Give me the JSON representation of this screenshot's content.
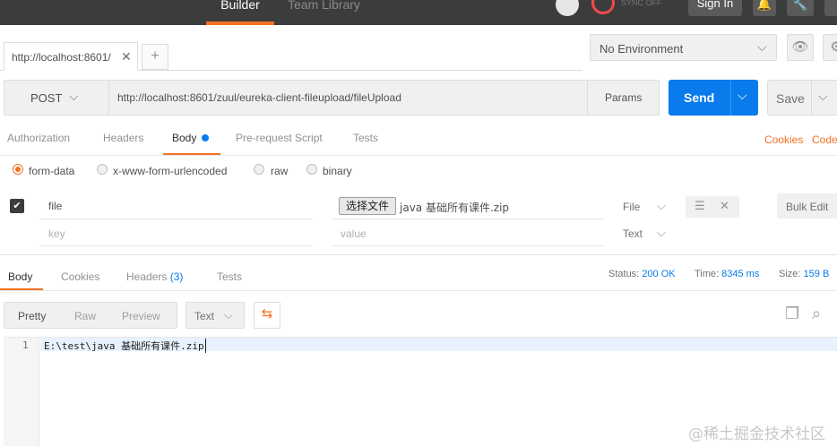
{
  "header": {
    "builder_tab": "Builder",
    "team_library_tab": "Team Library",
    "sync_label": "SYNC OFF",
    "sign_in": "Sign In"
  },
  "tabs": {
    "active_tab_label": "http://localhost:8601/",
    "close_glyph": "✕",
    "new_tab_glyph": "+"
  },
  "environment": {
    "selected": "No Environment",
    "chevron": "⌵"
  },
  "request": {
    "method": "POST",
    "url": "http://localhost:8601/zuul/eureka-client-fileupload/fileUpload",
    "params_label": "Params",
    "send_label": "Send",
    "save_label": "Save",
    "chevron": "⌵"
  },
  "request_tabs": {
    "authorization": "Authorization",
    "headers": "Headers",
    "body": "Body",
    "prerequest": "Pre-request Script",
    "tests": "Tests",
    "cookies_link": "Cookies",
    "code_link": "Code"
  },
  "body_types": {
    "form_data": "form-data",
    "urlencoded": "x-www-form-urlencoded",
    "raw": "raw",
    "binary": "binary"
  },
  "form_rows": [
    {
      "key": "file",
      "choose_file_label": "选择文件",
      "file_name": "java 基础所有课件.zip",
      "type": "File"
    },
    {
      "key_placeholder": "key",
      "value_placeholder": "value",
      "type": "Text"
    }
  ],
  "bulk_edit_label": "Bulk Edit",
  "response": {
    "tabs": {
      "body": "Body",
      "cookies": "Cookies",
      "headers": "Headers",
      "headers_count": "(3)",
      "tests": "Tests"
    },
    "status_label": "Status:",
    "status_value": "200 OK",
    "time_label": "Time:",
    "time_value": "8345 ms",
    "size_label": "Size:",
    "size_value": "159 B",
    "view_modes": [
      "Pretty",
      "Raw",
      "Preview"
    ],
    "format": "Text",
    "line_number": "1",
    "body_text": "E:\\test\\java 基础所有课件.zip"
  },
  "watermark": "@稀土掘金技术社区",
  "colors": {
    "accent_orange": "#f47023",
    "send_blue": "#097bed",
    "topbar": "#3c3c3c"
  }
}
